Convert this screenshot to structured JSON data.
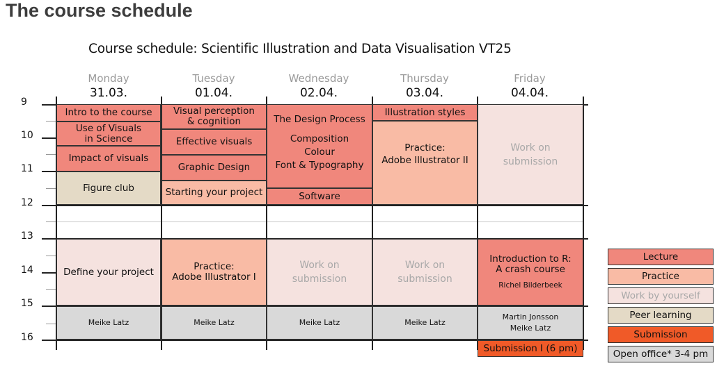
{
  "page_heading": "The course schedule",
  "schedule_title": "Course schedule: Scientific Illustration and Data Visualisation VT25",
  "days": [
    {
      "name": "Monday",
      "date": "31.03."
    },
    {
      "name": "Tuesday",
      "date": "01.04."
    },
    {
      "name": "Wednesday",
      "date": "02.04."
    },
    {
      "name": "Thursday",
      "date": "03.04."
    },
    {
      "name": "Friday",
      "date": "04.04."
    }
  ],
  "hours": [
    "9",
    "10",
    "11",
    "12",
    "13",
    "14",
    "15",
    "16"
  ],
  "colors": {
    "lecture": "#f0877c",
    "practice": "#f9bba5",
    "work": "#f5e2df",
    "peer": "#e4dac6",
    "submission": "#f05a28",
    "office": "#d9d9d9"
  },
  "sessions": {
    "mon_intro": "Intro to the course",
    "mon_visuals_1": "Use of Visuals",
    "mon_visuals_2": "in Science",
    "mon_impact": "Impact of visuals",
    "mon_figure": "Figure club",
    "mon_define": "Define your project",
    "mon_office": "Meike Latz",
    "tue_perception_1": "Visual perception",
    "tue_perception_2": "& cognition",
    "tue_effective": "Effective visuals",
    "tue_graphic": "Graphic Design",
    "tue_starting": "Starting your project",
    "tue_practice_1": "Practice:",
    "tue_practice_2": "Adobe Illustrator I",
    "tue_office": "Meike Latz",
    "wed_design": "The Design Process",
    "wed_comp_1": "Composition",
    "wed_comp_2": "Colour",
    "wed_comp_3": "Font & Typography",
    "wed_software": "Software",
    "wed_work_1": "Work on",
    "wed_work_2": "submission",
    "wed_office": "Meike Latz",
    "thu_styles": "Illustration styles",
    "thu_practice_1": "Practice:",
    "thu_practice_2": "Adobe Illustrator II",
    "thu_work_1": "Work on",
    "thu_work_2": "submission",
    "thu_office": "Meike Latz",
    "fri_work_1": "Work on",
    "fri_work_2": "submission",
    "fri_intro_1": "Introduction to R:",
    "fri_intro_2": "A crash course",
    "fri_intro_3": "Richel Bilderbeek",
    "fri_office_1": "Martin Jonsson",
    "fri_office_2": "Meike Latz",
    "fri_submission": "Submission I (6 pm)"
  },
  "legend": [
    "Lecture",
    "Practice",
    "Work by yourself",
    "Peer learning",
    "Submission",
    "Open office* 3-4 pm"
  ]
}
